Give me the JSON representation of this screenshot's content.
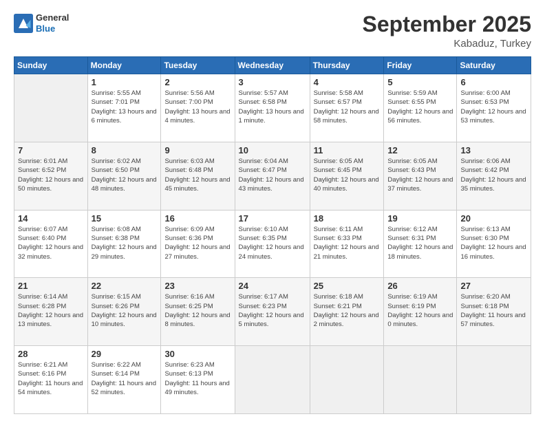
{
  "header": {
    "logo_line1": "General",
    "logo_line2": "Blue",
    "main_title": "September 2025",
    "subtitle": "Kabaduz, Turkey"
  },
  "days_of_week": [
    "Sunday",
    "Monday",
    "Tuesday",
    "Wednesday",
    "Thursday",
    "Friday",
    "Saturday"
  ],
  "weeks": [
    [
      {
        "day": "",
        "sunrise": "",
        "sunset": "",
        "daylight": "",
        "empty": true
      },
      {
        "day": "1",
        "sunrise": "Sunrise: 5:55 AM",
        "sunset": "Sunset: 7:01 PM",
        "daylight": "Daylight: 13 hours and 6 minutes.",
        "empty": false
      },
      {
        "day": "2",
        "sunrise": "Sunrise: 5:56 AM",
        "sunset": "Sunset: 7:00 PM",
        "daylight": "Daylight: 13 hours and 4 minutes.",
        "empty": false
      },
      {
        "day": "3",
        "sunrise": "Sunrise: 5:57 AM",
        "sunset": "Sunset: 6:58 PM",
        "daylight": "Daylight: 13 hours and 1 minute.",
        "empty": false
      },
      {
        "day": "4",
        "sunrise": "Sunrise: 5:58 AM",
        "sunset": "Sunset: 6:57 PM",
        "daylight": "Daylight: 12 hours and 58 minutes.",
        "empty": false
      },
      {
        "day": "5",
        "sunrise": "Sunrise: 5:59 AM",
        "sunset": "Sunset: 6:55 PM",
        "daylight": "Daylight: 12 hours and 56 minutes.",
        "empty": false
      },
      {
        "day": "6",
        "sunrise": "Sunrise: 6:00 AM",
        "sunset": "Sunset: 6:53 PM",
        "daylight": "Daylight: 12 hours and 53 minutes.",
        "empty": false
      }
    ],
    [
      {
        "day": "7",
        "sunrise": "Sunrise: 6:01 AM",
        "sunset": "Sunset: 6:52 PM",
        "daylight": "Daylight: 12 hours and 50 minutes.",
        "empty": false
      },
      {
        "day": "8",
        "sunrise": "Sunrise: 6:02 AM",
        "sunset": "Sunset: 6:50 PM",
        "daylight": "Daylight: 12 hours and 48 minutes.",
        "empty": false
      },
      {
        "day": "9",
        "sunrise": "Sunrise: 6:03 AM",
        "sunset": "Sunset: 6:48 PM",
        "daylight": "Daylight: 12 hours and 45 minutes.",
        "empty": false
      },
      {
        "day": "10",
        "sunrise": "Sunrise: 6:04 AM",
        "sunset": "Sunset: 6:47 PM",
        "daylight": "Daylight: 12 hours and 43 minutes.",
        "empty": false
      },
      {
        "day": "11",
        "sunrise": "Sunrise: 6:05 AM",
        "sunset": "Sunset: 6:45 PM",
        "daylight": "Daylight: 12 hours and 40 minutes.",
        "empty": false
      },
      {
        "day": "12",
        "sunrise": "Sunrise: 6:05 AM",
        "sunset": "Sunset: 6:43 PM",
        "daylight": "Daylight: 12 hours and 37 minutes.",
        "empty": false
      },
      {
        "day": "13",
        "sunrise": "Sunrise: 6:06 AM",
        "sunset": "Sunset: 6:42 PM",
        "daylight": "Daylight: 12 hours and 35 minutes.",
        "empty": false
      }
    ],
    [
      {
        "day": "14",
        "sunrise": "Sunrise: 6:07 AM",
        "sunset": "Sunset: 6:40 PM",
        "daylight": "Daylight: 12 hours and 32 minutes.",
        "empty": false
      },
      {
        "day": "15",
        "sunrise": "Sunrise: 6:08 AM",
        "sunset": "Sunset: 6:38 PM",
        "daylight": "Daylight: 12 hours and 29 minutes.",
        "empty": false
      },
      {
        "day": "16",
        "sunrise": "Sunrise: 6:09 AM",
        "sunset": "Sunset: 6:36 PM",
        "daylight": "Daylight: 12 hours and 27 minutes.",
        "empty": false
      },
      {
        "day": "17",
        "sunrise": "Sunrise: 6:10 AM",
        "sunset": "Sunset: 6:35 PM",
        "daylight": "Daylight: 12 hours and 24 minutes.",
        "empty": false
      },
      {
        "day": "18",
        "sunrise": "Sunrise: 6:11 AM",
        "sunset": "Sunset: 6:33 PM",
        "daylight": "Daylight: 12 hours and 21 minutes.",
        "empty": false
      },
      {
        "day": "19",
        "sunrise": "Sunrise: 6:12 AM",
        "sunset": "Sunset: 6:31 PM",
        "daylight": "Daylight: 12 hours and 18 minutes.",
        "empty": false
      },
      {
        "day": "20",
        "sunrise": "Sunrise: 6:13 AM",
        "sunset": "Sunset: 6:30 PM",
        "daylight": "Daylight: 12 hours and 16 minutes.",
        "empty": false
      }
    ],
    [
      {
        "day": "21",
        "sunrise": "Sunrise: 6:14 AM",
        "sunset": "Sunset: 6:28 PM",
        "daylight": "Daylight: 12 hours and 13 minutes.",
        "empty": false
      },
      {
        "day": "22",
        "sunrise": "Sunrise: 6:15 AM",
        "sunset": "Sunset: 6:26 PM",
        "daylight": "Daylight: 12 hours and 10 minutes.",
        "empty": false
      },
      {
        "day": "23",
        "sunrise": "Sunrise: 6:16 AM",
        "sunset": "Sunset: 6:25 PM",
        "daylight": "Daylight: 12 hours and 8 minutes.",
        "empty": false
      },
      {
        "day": "24",
        "sunrise": "Sunrise: 6:17 AM",
        "sunset": "Sunset: 6:23 PM",
        "daylight": "Daylight: 12 hours and 5 minutes.",
        "empty": false
      },
      {
        "day": "25",
        "sunrise": "Sunrise: 6:18 AM",
        "sunset": "Sunset: 6:21 PM",
        "daylight": "Daylight: 12 hours and 2 minutes.",
        "empty": false
      },
      {
        "day": "26",
        "sunrise": "Sunrise: 6:19 AM",
        "sunset": "Sunset: 6:19 PM",
        "daylight": "Daylight: 12 hours and 0 minutes.",
        "empty": false
      },
      {
        "day": "27",
        "sunrise": "Sunrise: 6:20 AM",
        "sunset": "Sunset: 6:18 PM",
        "daylight": "Daylight: 11 hours and 57 minutes.",
        "empty": false
      }
    ],
    [
      {
        "day": "28",
        "sunrise": "Sunrise: 6:21 AM",
        "sunset": "Sunset: 6:16 PM",
        "daylight": "Daylight: 11 hours and 54 minutes.",
        "empty": false
      },
      {
        "day": "29",
        "sunrise": "Sunrise: 6:22 AM",
        "sunset": "Sunset: 6:14 PM",
        "daylight": "Daylight: 11 hours and 52 minutes.",
        "empty": false
      },
      {
        "day": "30",
        "sunrise": "Sunrise: 6:23 AM",
        "sunset": "Sunset: 6:13 PM",
        "daylight": "Daylight: 11 hours and 49 minutes.",
        "empty": false
      },
      {
        "day": "",
        "sunrise": "",
        "sunset": "",
        "daylight": "",
        "empty": true
      },
      {
        "day": "",
        "sunrise": "",
        "sunset": "",
        "daylight": "",
        "empty": true
      },
      {
        "day": "",
        "sunrise": "",
        "sunset": "",
        "daylight": "",
        "empty": true
      },
      {
        "day": "",
        "sunrise": "",
        "sunset": "",
        "daylight": "",
        "empty": true
      }
    ]
  ]
}
